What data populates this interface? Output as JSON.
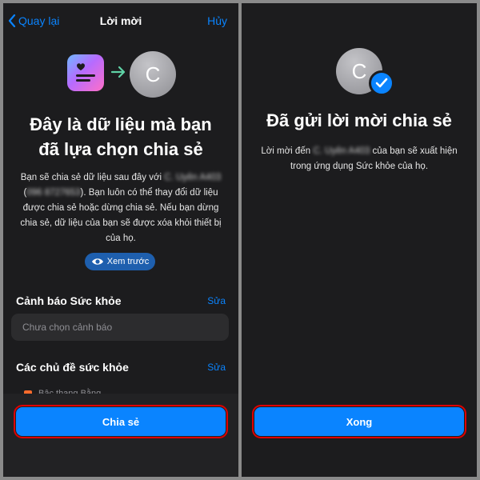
{
  "left": {
    "nav": {
      "back_label": "Quay lại",
      "title": "Lời mời",
      "cancel_label": "Hủy"
    },
    "avatar_initial": "C",
    "headline_line1": "Đây là dữ liệu mà bạn",
    "headline_line2": "đã lựa chọn chia sẻ",
    "body_text": {
      "part1": "Bạn sẽ chia sẻ dữ liệu sau đây với",
      "blurred_name": "C. Uyên A403",
      "blurred_phone": "096 8727653",
      "part2": ". Bạn luôn có thể thay đổi dữ liệu được chia sẻ hoặc dừng chia sẻ. Nếu bạn dừng chia sẻ, dữ liệu của bạn sẽ được xóa khỏi thiết bị của họ."
    },
    "preview_label": "Xem trước",
    "health_alert": {
      "title": "Cảnh báo Sức khỏe",
      "edit_label": "Sửa",
      "placeholder": "Chưa chọn cảnh báo"
    },
    "health_topics": {
      "title": "Các chủ đề sức khỏe",
      "edit_label": "Sửa",
      "peek_item": "Bậc thang Bằng"
    },
    "share_button": "Chia sẻ"
  },
  "right": {
    "avatar_initial": "C",
    "headline": "Đã gửi lời mời chia sẻ",
    "body_text": {
      "part1": "Lời mời đến",
      "blurred_name": "C. Uyên A403",
      "part2": "của bạn sẽ xuất hiện trong ứng dụng Sức khỏe của họ."
    },
    "done_button": "Xong"
  },
  "colors": {
    "accent": "#0a84ff",
    "background": "#1c1c1e",
    "highlight_outline": "#e00000"
  }
}
